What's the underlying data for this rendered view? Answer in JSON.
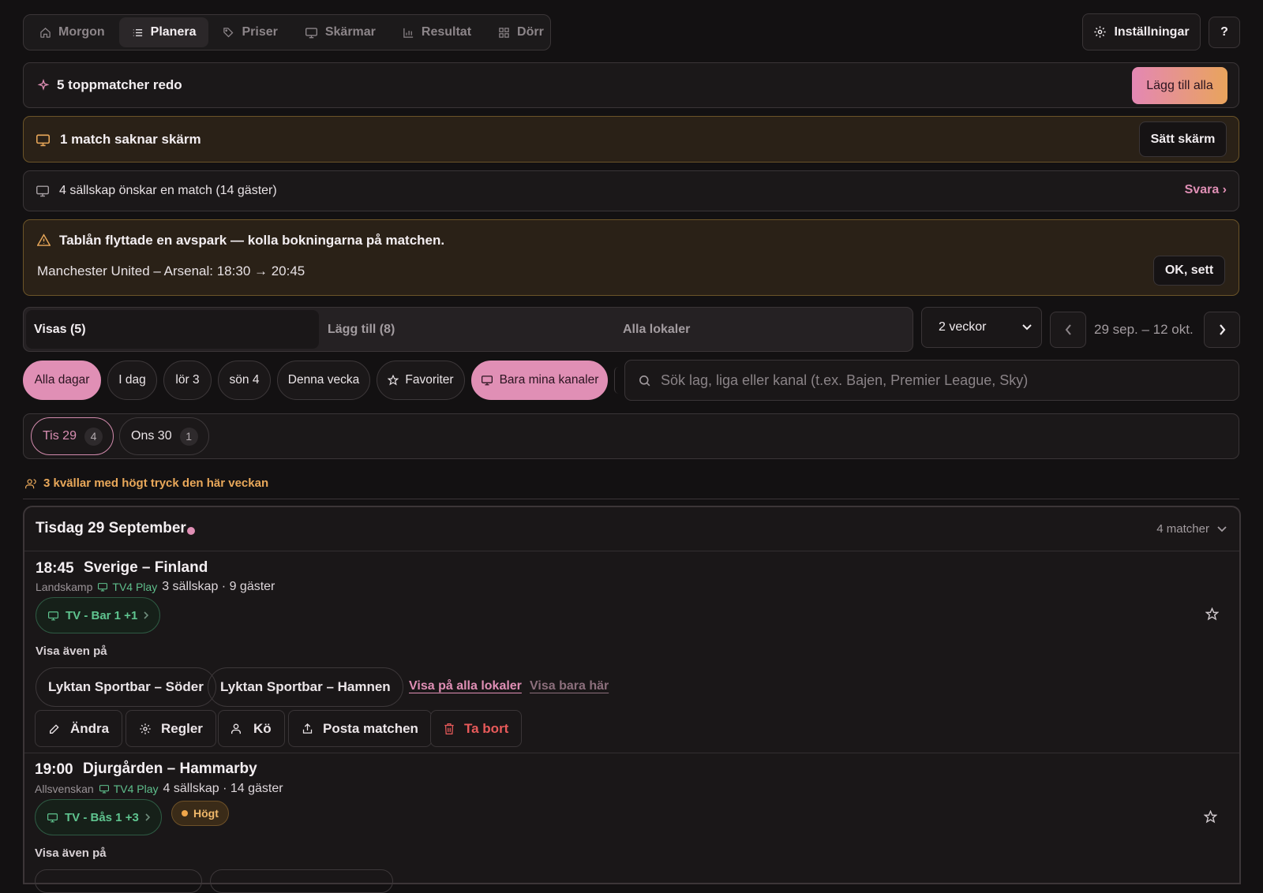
{
  "nav": {
    "tabs": [
      {
        "label": "Morgon",
        "icon": "home-icon"
      },
      {
        "label": "Planera",
        "icon": "list-icon",
        "active": true
      },
      {
        "label": "Priser",
        "icon": "tag-icon"
      },
      {
        "label": "Skärmar",
        "icon": "monitor-icon"
      },
      {
        "label": "Resultat",
        "icon": "bar-chart-icon"
      },
      {
        "label": "Dörr",
        "icon": "grid-icon"
      }
    ],
    "settings_label": "Inställningar",
    "help_label": "?"
  },
  "banners": {
    "top_matches": {
      "text": "5 toppmatcher redo",
      "button": "Lägg till alla"
    },
    "missing_screen": {
      "text": "1 match saknar skärm",
      "button": "Sätt skärm"
    },
    "requests": {
      "text": "4 sällskap önskar en match (14 gäster)",
      "link": "Svara ›"
    },
    "schedule_change": {
      "title": "Tablån flyttade en avspark — kolla bokningarna på matchen.",
      "detail": "Manchester United – Arsenal: 18:30 → 20:45",
      "button": "OK, sett"
    }
  },
  "segments": {
    "shown": "Visas (5)",
    "add": "Lägg till (8)",
    "all": "Alla lokaler"
  },
  "range_select": {
    "value": "2 veckor"
  },
  "date_nav": {
    "prev": "‹",
    "range": "29 sep. – 12 okt.",
    "next": "›"
  },
  "filters": {
    "all_days": "Alla dagar",
    "today": "I dag",
    "sat": "lör 3",
    "sun": "sön 4",
    "week": "Denna vecka",
    "favorites": "Favoriter",
    "my_channels": "Bara mina kanaler"
  },
  "search": {
    "placeholder": "Sök lag, liga eller kanal (t.ex. Bajen, Premier League, Sky)"
  },
  "days": [
    {
      "label": "Tis 29",
      "count": "4",
      "active": true
    },
    {
      "label": "Ons 30",
      "count": "1"
    }
  ],
  "pressure_note": "3 kvällar med högt tryck den här veckan",
  "day_section": {
    "title": "Tisdag 29 September",
    "count": "4 matcher",
    "accent": "#e08fb5"
  },
  "matches": [
    {
      "time": "18:45",
      "title": "Sverige – Finland",
      "league": "Landskamp",
      "channel": "TV4 Play",
      "guests": "3 sällskap · 9 gäster",
      "screen": "TV - Bar 1 +1",
      "also_label": "Visa även på",
      "venues": [
        "Lyktan Sportbar – Söder",
        "Lyktan Sportbar – Hamnen"
      ],
      "link_all": "Visa på alla lokaler",
      "link_only": "Visa bara här",
      "actions": {
        "edit": "Ändra",
        "rules": "Regler",
        "queue": "Kö",
        "post": "Posta matchen",
        "delete": "Ta bort"
      }
    },
    {
      "time": "19:00",
      "title": "Djurgården – Hammarby",
      "league": "Allsvenskan",
      "channel": "TV4 Play",
      "guests": "4 sällskap · 14 gäster",
      "screen": "TV - Bås 1 +3",
      "badge": "Högt",
      "also_label": "Visa även på"
    }
  ]
}
